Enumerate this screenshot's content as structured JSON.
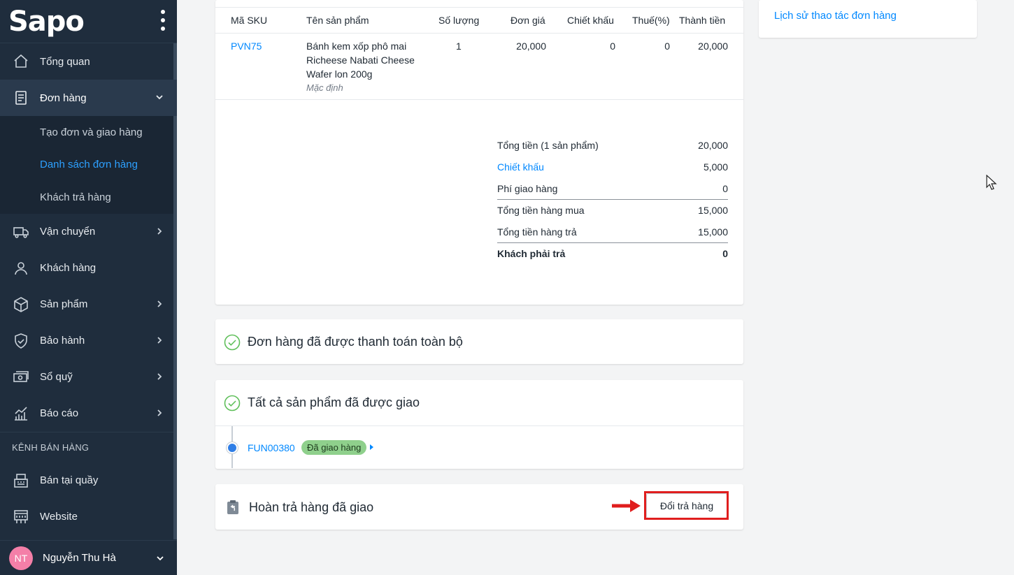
{
  "brand": {
    "logo": "Sapo"
  },
  "sidebar": {
    "items": [
      {
        "label": "Tổng quan",
        "icon": "home-icon"
      },
      {
        "label": "Đơn hàng",
        "icon": "order-icon"
      },
      {
        "label": "Vận chuyển",
        "icon": "truck-icon"
      },
      {
        "label": "Khách hàng",
        "icon": "user-icon"
      },
      {
        "label": "Sản phẩm",
        "icon": "box-icon"
      },
      {
        "label": "Bảo hành",
        "icon": "shield-icon"
      },
      {
        "label": "Sổ quỹ",
        "icon": "cash-icon"
      },
      {
        "label": "Báo cáo",
        "icon": "chart-icon"
      }
    ],
    "sub_items": [
      {
        "label": "Tạo đơn và giao hàng"
      },
      {
        "label": "Danh sách đơn hàng"
      },
      {
        "label": "Khách trả hàng"
      }
    ],
    "channel_section": "KÊNH BÁN HÀNG",
    "channels": [
      {
        "label": "Bán tại quầy",
        "icon": "pos-icon"
      },
      {
        "label": "Website",
        "icon": "website-icon"
      }
    ],
    "user": {
      "initials": "NT",
      "name": "Nguyễn Thu Hà"
    }
  },
  "order_table": {
    "headers": [
      "Mã SKU",
      "Tên sản phẩm",
      "Số lượng",
      "Đơn giá",
      "Chiết khấu",
      "Thuế(%)",
      "Thành tiền"
    ],
    "rows": [
      {
        "sku": "PVN75",
        "name": "Bánh kem xốp phô mai Richeese Nabati Cheese Wafer lon 200g",
        "variant": "Mặc định",
        "qty": "1",
        "price": "20,000",
        "discount": "0",
        "tax": "0",
        "total": "20,000"
      }
    ]
  },
  "summary": [
    {
      "label": "Tổng tiền (1 sản phẩm)",
      "value": "20,000"
    },
    {
      "label": "Chiết khấu",
      "value": "5,000"
    },
    {
      "label": "Phí giao hàng",
      "value": "0"
    },
    {
      "label": "Tổng tiền hàng mua",
      "value": "15,000"
    },
    {
      "label": "Tổng tiền hàng trả",
      "value": "15,000"
    },
    {
      "label": "Khách phải trả",
      "value": "0"
    }
  ],
  "payment": {
    "title": "Đơn hàng đã được thanh toán toàn bộ"
  },
  "fulfillment": {
    "title": "Tất cả sản phẩm đã được giao",
    "shipment_code": "FUN00380",
    "status": "Đã giao hàng"
  },
  "returns": {
    "title": "Hoàn trả hàng đã giao",
    "button": "Đổi trả hàng"
  },
  "history": {
    "link": "Lịch sử thao tác đơn hàng"
  },
  "colors": {
    "accent": "#0088ff",
    "sidebar": "#1f2d3d",
    "success": "#8fd08c",
    "highlight": "#e01e1e"
  }
}
